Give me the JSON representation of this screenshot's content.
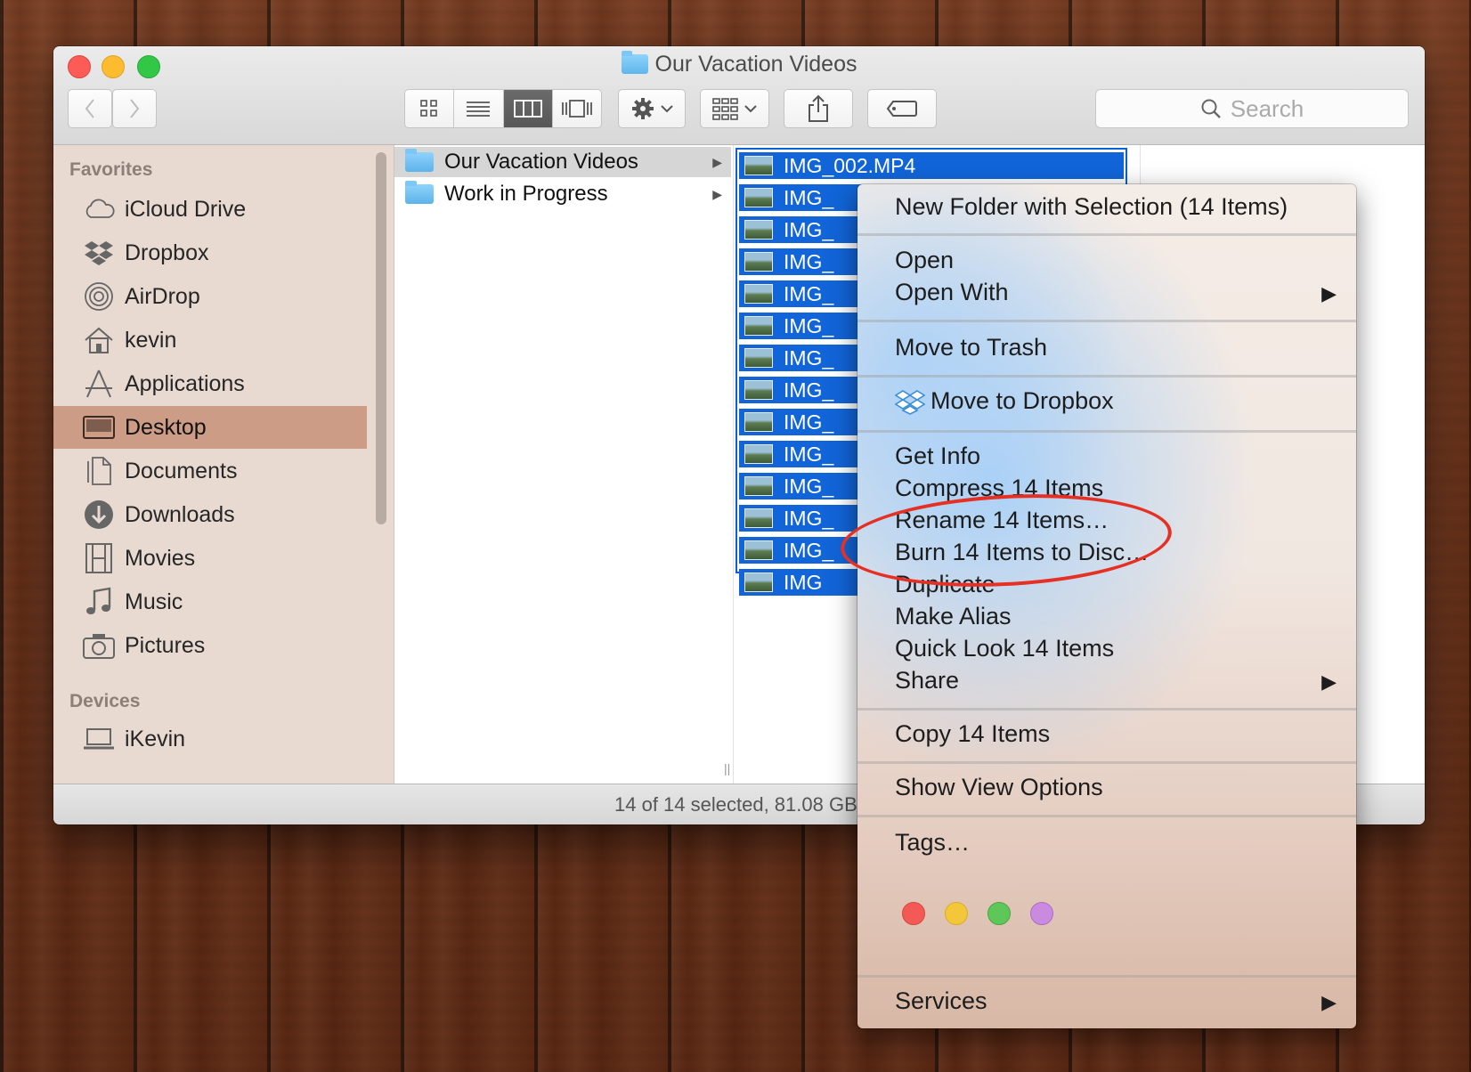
{
  "window": {
    "title": "Our Vacation Videos"
  },
  "toolbar": {
    "search_placeholder": "Search"
  },
  "sidebar": {
    "favorites_header": "Favorites",
    "devices_header": "Devices",
    "items": [
      {
        "label": "iCloud Drive",
        "icon": "cloud-icon"
      },
      {
        "label": "Dropbox",
        "icon": "dropbox-icon"
      },
      {
        "label": "AirDrop",
        "icon": "airdrop-icon"
      },
      {
        "label": "kevin",
        "icon": "home-icon"
      },
      {
        "label": "Applications",
        "icon": "applications-icon"
      },
      {
        "label": "Desktop",
        "icon": "desktop-icon"
      },
      {
        "label": "Documents",
        "icon": "documents-icon"
      },
      {
        "label": "Downloads",
        "icon": "downloads-icon"
      },
      {
        "label": "Movies",
        "icon": "movies-icon"
      },
      {
        "label": "Music",
        "icon": "music-icon"
      },
      {
        "label": "Pictures",
        "icon": "camera-icon"
      }
    ],
    "devices": [
      {
        "label": "iKevin",
        "icon": "laptop-icon"
      }
    ]
  },
  "column1": {
    "rows": [
      {
        "label": "Our Vacation Videos"
      },
      {
        "label": "Work in Progress"
      }
    ]
  },
  "column2": {
    "files": [
      "IMG_002.MP4",
      "IMG_",
      "IMG_",
      "IMG_",
      "IMG_",
      "IMG_",
      "IMG_",
      "IMG_",
      "IMG_",
      "IMG_",
      "IMG_",
      "IMG_",
      "IMG_",
      "IMG"
    ]
  },
  "statusbar": {
    "text": "14 of 14 selected, 81.08 GB ava"
  },
  "context_menu": {
    "new_folder": "New Folder with Selection (14 Items)",
    "open": "Open",
    "open_with": "Open With",
    "move_to_trash": "Move to Trash",
    "move_to_dropbox": "Move to Dropbox",
    "get_info": "Get Info",
    "compress": "Compress 14 Items",
    "rename": "Rename 14 Items…",
    "burn": "Burn 14 Items to Disc…",
    "duplicate": "Duplicate",
    "make_alias": "Make Alias",
    "quick_look": "Quick Look 14 Items",
    "share": "Share",
    "copy": "Copy 14 Items",
    "show_view_options": "Show View Options",
    "tags": "Tags…",
    "services": "Services",
    "tag_colors": [
      "#f45a55",
      "#f4c73a",
      "#5fc65a",
      "#c98ae0"
    ]
  },
  "colors": {
    "selection_blue": "#1165d9",
    "sidebar_selected": "#cc9c87",
    "annotation_red": "#e63024"
  }
}
